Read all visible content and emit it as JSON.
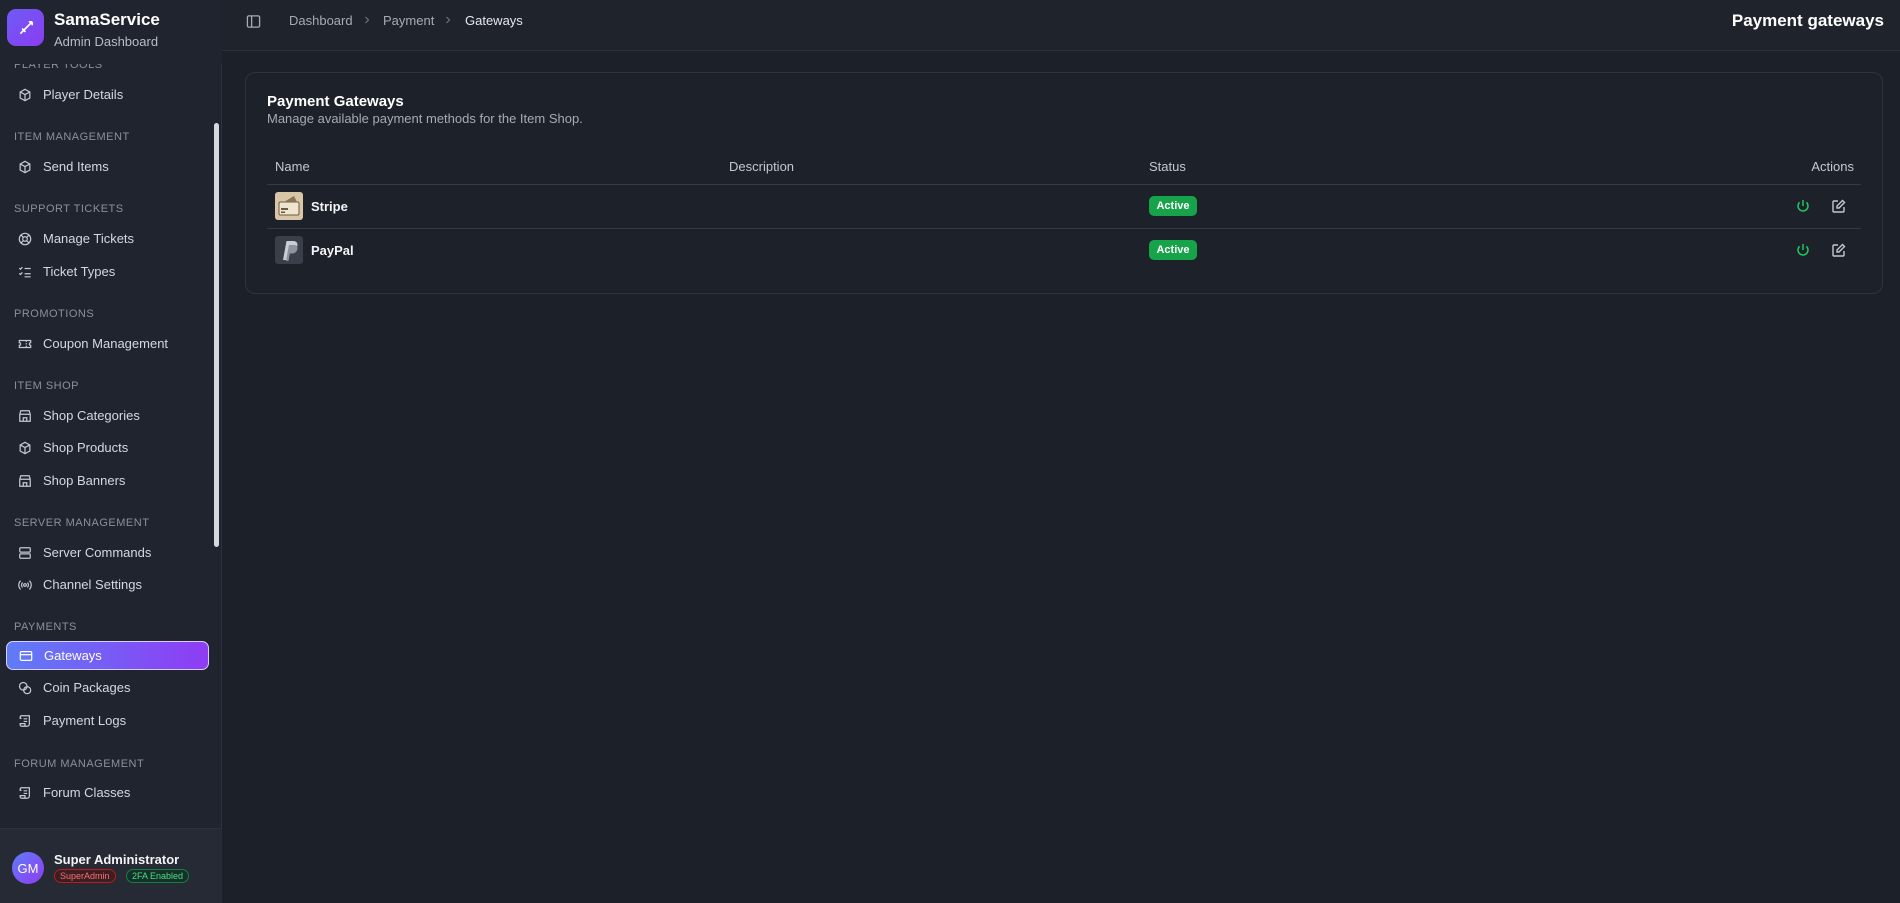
{
  "brand": {
    "title": "SamaService",
    "subtitle": "Admin Dashboard"
  },
  "sidebar": {
    "sections": [
      {
        "label": "Player Tools",
        "items": [
          {
            "label": "Player Details",
            "icon": "cube-icon"
          }
        ]
      },
      {
        "label": "Item Management",
        "items": [
          {
            "label": "Send Items",
            "icon": "cube-icon"
          }
        ]
      },
      {
        "label": "Support Tickets",
        "items": [
          {
            "label": "Manage Tickets",
            "icon": "lifebuoy-icon"
          },
          {
            "label": "Ticket Types",
            "icon": "list-check-icon"
          }
        ]
      },
      {
        "label": "Promotions",
        "items": [
          {
            "label": "Coupon Management",
            "icon": "ticket-icon"
          }
        ]
      },
      {
        "label": "Item Shop",
        "items": [
          {
            "label": "Shop Categories",
            "icon": "store-icon"
          },
          {
            "label": "Shop Products",
            "icon": "cube-icon"
          },
          {
            "label": "Shop Banners",
            "icon": "store-icon"
          }
        ]
      },
      {
        "label": "Server Management",
        "items": [
          {
            "label": "Server Commands",
            "icon": "server-icon"
          },
          {
            "label": "Channel Settings",
            "icon": "radio-icon"
          }
        ]
      },
      {
        "label": "Payments",
        "items": [
          {
            "label": "Gateways",
            "icon": "credit-card-icon",
            "active": true
          },
          {
            "label": "Coin Packages",
            "icon": "coins-icon"
          },
          {
            "label": "Payment Logs",
            "icon": "scroll-icon"
          }
        ]
      },
      {
        "label": "Forum Management",
        "items": [
          {
            "label": "Forum Classes",
            "icon": "scroll-icon"
          }
        ]
      }
    ]
  },
  "user": {
    "initials": "GM",
    "name": "Super Administrator",
    "role_badge": "SuperAdmin",
    "twofa_badge": "2FA Enabled"
  },
  "breadcrumb": {
    "items": [
      "Dashboard",
      "Payment",
      "Gateways"
    ]
  },
  "header": {
    "title": "Payment gateways",
    "toggle_icon": "sidebar-toggle-icon"
  },
  "card": {
    "title": "Payment Gateways",
    "subtitle": "Manage available payment methods for the Item Shop.",
    "columns": [
      "Name",
      "Description",
      "Status",
      "Actions"
    ],
    "rows": [
      {
        "name": "Stripe",
        "description": "",
        "status": "Active",
        "logo": "stripe-logo-icon"
      },
      {
        "name": "PayPal",
        "description": "",
        "status": "Active",
        "logo": "paypal-logo-icon"
      }
    ]
  },
  "colors": {
    "accent_start": "#5f7cf7",
    "accent_end": "#8f3cf3",
    "status_active": "#16a34a",
    "power_icon": "#22c55e"
  }
}
